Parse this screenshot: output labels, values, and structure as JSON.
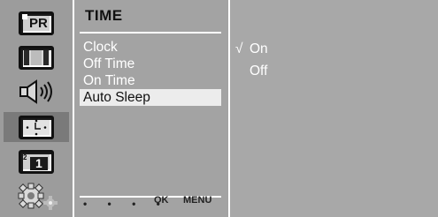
{
  "sidebar": {
    "icons": [
      {
        "name": "picture-icon",
        "label": "PR"
      },
      {
        "name": "screen-icon",
        "label": ""
      },
      {
        "name": "sound-icon",
        "label": ""
      },
      {
        "name": "time-icon",
        "label": ""
      },
      {
        "name": "option-icon",
        "label": "1"
      },
      {
        "name": "settings-icon",
        "label": ""
      }
    ],
    "selected_index": 3
  },
  "menu": {
    "title": "TIME",
    "items": [
      "Clock",
      "Off Time",
      "On Time",
      "Auto Sleep"
    ],
    "selected_index": 3
  },
  "options": {
    "items": [
      {
        "label": "On",
        "checked": true
      },
      {
        "label": "Off",
        "checked": false
      }
    ],
    "check_mark": "√"
  },
  "footer": {
    "dots": "• • • •",
    "ok_label": "OK",
    "menu_label": "MENU"
  },
  "colors": {
    "panel": "#a3a3a3",
    "selected_item": "#ececec",
    "icon_column": "#9c9c9c"
  }
}
